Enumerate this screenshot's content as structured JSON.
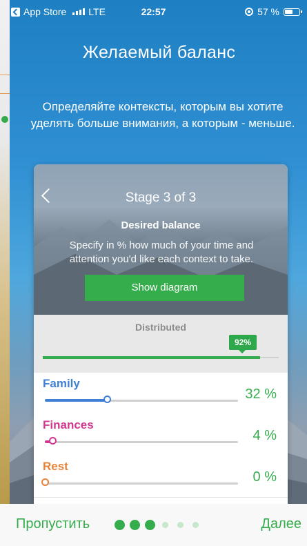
{
  "status_bar": {
    "back_app": "App Store",
    "network": "LTE",
    "time": "22:57",
    "battery": "57 %"
  },
  "screen": {
    "title": "Желаемый баланс",
    "description": "Определяйте контексты, которым вы хотите уделять больше внимания, а которым - меньше."
  },
  "card": {
    "stage": "Stage 3 of 3",
    "subtitle": "Desired balance",
    "info": "Specify in % how much of your time and attention you'd like each context to take.",
    "show_button": "Show diagram",
    "distributed_label": "Distributed",
    "distributed_value": "92%",
    "distributed_fraction": 0.92
  },
  "contexts": [
    {
      "name": "Family",
      "value": "32 %",
      "color": "#3f7fd4",
      "level": 0.32
    },
    {
      "name": "Finances",
      "value": "4 %",
      "color": "#d1388f",
      "level": 0.04
    },
    {
      "name": "Rest",
      "value": "0 %",
      "color": "#e8833a",
      "level": 0.0
    }
  ],
  "footer": {
    "skip": "Пропустить",
    "next": "Далее",
    "page_dots": {
      "total": 6,
      "active": 3
    }
  },
  "colors": {
    "accent": "#35ad4c"
  }
}
